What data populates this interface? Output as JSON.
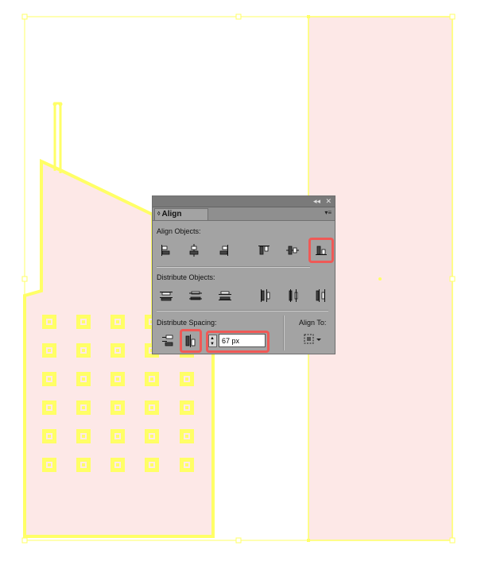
{
  "panel": {
    "title": "Align",
    "collapse_glyph": "◂◂",
    "close_glyph": "✕",
    "menu_glyph": "▾≡",
    "tab_arrows": "◊"
  },
  "sections": {
    "align_objects": "Align Objects:",
    "distribute_objects": "Distribute Objects:",
    "distribute_spacing": "Distribute Spacing:",
    "align_to": "Align To:"
  },
  "spacing": {
    "value": "67 px"
  },
  "colors": {
    "highlight": "#ef5956",
    "selection": "#ffff66",
    "fill": "#fde8e7"
  },
  "icons": {
    "align_objects": [
      "align-left-icon",
      "align-horizontal-center-icon",
      "align-right-icon",
      "align-top-icon",
      "align-vertical-center-icon",
      "align-bottom-icon"
    ],
    "distribute_objects": [
      "distribute-top-icon",
      "distribute-vertical-center-icon",
      "distribute-bottom-icon",
      "distribute-left-icon",
      "distribute-horizontal-center-icon",
      "distribute-right-icon"
    ],
    "distribute_spacing": [
      "vertical-distribute-space-icon",
      "horizontal-distribute-space-icon"
    ],
    "align_to": "align-to-selection-icon"
  }
}
